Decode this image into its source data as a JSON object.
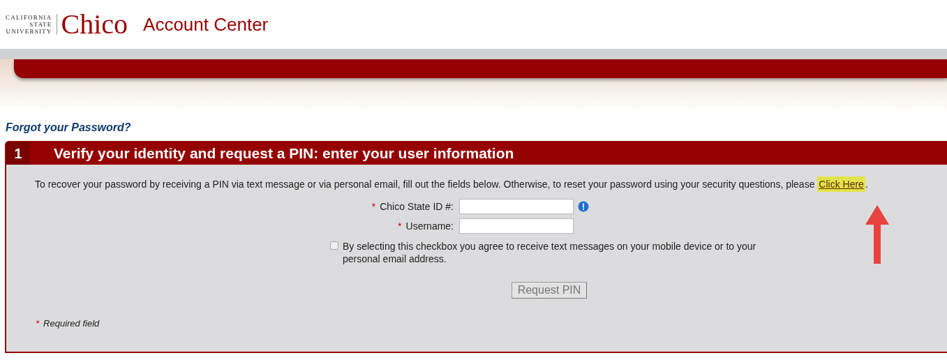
{
  "header": {
    "logo": {
      "lines": [
        "CALIFORNIA",
        "STATE",
        "UNIVERSITY"
      ],
      "name": "Chico"
    },
    "title": "Account Center"
  },
  "page_title": "Forgot your Password?",
  "step": {
    "number": "1",
    "title": "Verify your identity and request a PIN: enter your user information",
    "intro": "To recover your password by receiving a PIN via text message or via personal email, fill out the fields below. Otherwise, to reset your password using your security questions, please ",
    "link": "Click Here",
    "after_link": ".",
    "fields": [
      {
        "required_mark": "*",
        "label": "Chico State ID #:",
        "info": true
      },
      {
        "required_mark": "*",
        "label": "Username:",
        "info": false
      }
    ],
    "consent": {
      "checked": false,
      "label": "By selecting this checkbox you agree to receive text messages on your mobile device or to your personal email address."
    },
    "button": {
      "label": "Request PIN",
      "disabled": true
    },
    "footnote": {
      "mark": "*",
      "text": "Required field"
    }
  }
}
